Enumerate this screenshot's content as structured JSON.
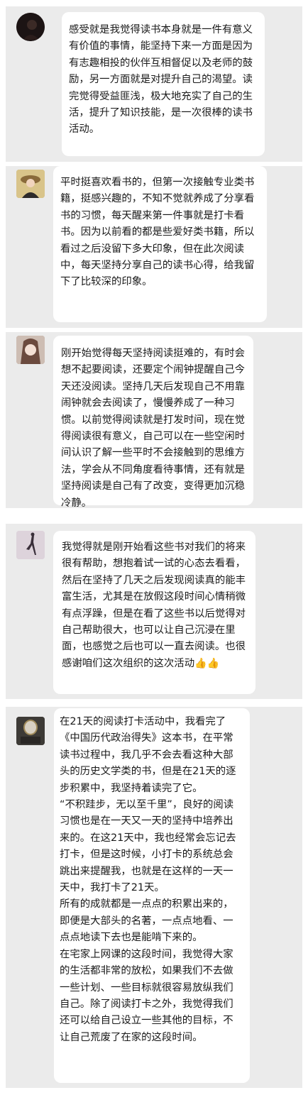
{
  "messages": [
    {
      "avatar": "dark-portrait-avatar",
      "paragraphs": [
        "感受就是我觉得读书本身就是一件有意义有价值的事情，能坚持下来一方面是因为有志趣相投的伙伴互相督促以及老师的鼓励，另一方面就是对提升自己的渴望。读完觉得受益匪浅，极大地充实了自己的生活，提升了知识技能，是一次很棒的读书活动。"
      ]
    },
    {
      "avatar": "girl-with-hat-avatar",
      "paragraphs": [
        "平时挺喜欢看书的，但第一次接触专业类书籍，挺感兴趣的，不知不觉就养成了分享看书的习惯，每天醒来第一件事就是打卡看书。因为以前看的都是些爱好类书籍，所以看过之后没留下多大印象，但在此次阅读中，每天坚持分享自己的读书心得，给我留下了比较深的印象。"
      ]
    },
    {
      "avatar": "anime-character-avatar",
      "paragraphs": [
        "刚开始觉得每天坚持阅读挺难的，有时会想不起要阅读，还要定个闹钟提醒自己今天还没阅读。坚持几天后发现自己不用靠闹钟就会去阅读了，慢慢养成了一种习惯。以前觉得阅读就是打发时间，现在觉得阅读很有意义，自己可以在一些空闲时间认识了解一些平时不会接触到的思维方法，学会从不同角度看待事情，还有就是坚持阅读是自己有了改变，变得更加沉稳冷静。"
      ]
    },
    {
      "avatar": "dancer-silhouette-avatar",
      "paragraphs": [
        "我觉得就是刚开始看这些书对我们的将来很有帮助，想抱着试一试的心态去看看，然后在坚持了几天之后发现阅读真的能丰富生活，尤其是在放假这段时间心情稍微有点浮躁，但是在看了这些书以后觉得对自己帮助很大，也可以让自己沉浸在里面，也感觉之后也可以一直去阅读。也很感谢咱们这次组织的这次活动"
      ],
      "emoji": "👍👍"
    },
    {
      "avatar": "mirror-room-avatar",
      "paragraphs": [
        "在21天的阅读打卡活动中，我看完了《中国历代政治得失》这本书，在平常读书过程中，我几乎不会去看这种大部头的历史文学类的书，但是在21天的逐步积累中，我坚持着读完了它。",
        "“不积跬步，无以至千里”，良好的阅读习惯也是在一天又一天的坚持中培养出来的。在这21天中，我也经常会忘记去打卡，但是这时候，小打卡的系统总会跳出来提醒我，也就是在这样的一天一天中，我打卡了21天。",
        "所有的成就都是一点点的积累出来的，即便是大部头的名著，一点点地看、一点点地读下去也是能啃下来的。",
        "在宅家上网课的这段时间，我觉得大家的生活都非常的放松，如果我们不去做一些计划、一些目标就很容易放纵我们自己。除了阅读打卡之外，我觉得我们还可以给自己设立一些其他的目标，不让自己荒废了在家的这段时间。"
      ]
    }
  ]
}
